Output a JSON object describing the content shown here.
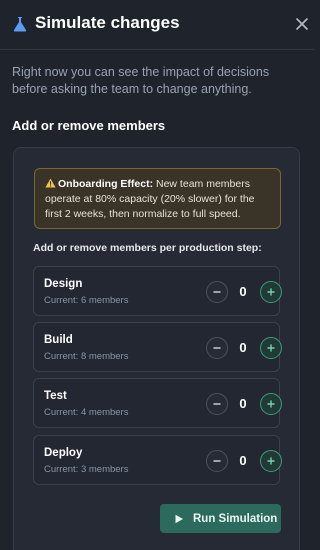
{
  "header": {
    "title": "Simulate changes",
    "icon": "flask-icon",
    "close_icon": "close-icon"
  },
  "intro": "Right now you can see the impact of decisions before asking the team to change anything.",
  "section_title": "Add or remove members",
  "warning": {
    "icon": "warning-icon",
    "label": "Onboarding Effect:",
    "text": " New team members operate at 80% capacity (20% slower) for the first 2 weeks, then normalize to full speed."
  },
  "steps_label": "Add or remove members per production step:",
  "steps": [
    {
      "name": "Design",
      "current": "Current: 6 members",
      "count": "0"
    },
    {
      "name": "Build",
      "current": "Current: 8 members",
      "count": "0"
    },
    {
      "name": "Test",
      "current": "Current: 4 members",
      "count": "0"
    },
    {
      "name": "Deploy",
      "current": "Current: 3 members",
      "count": "0"
    }
  ],
  "run_button": {
    "label": "Run Simulation",
    "icon": "play-icon"
  },
  "colors": {
    "background": "#1f232c",
    "card": "#252a34",
    "warning_bg": "#3a3428",
    "warning_border": "#7a6533",
    "accent": "#3f9b83",
    "run_button": "#2b6a5c"
  }
}
